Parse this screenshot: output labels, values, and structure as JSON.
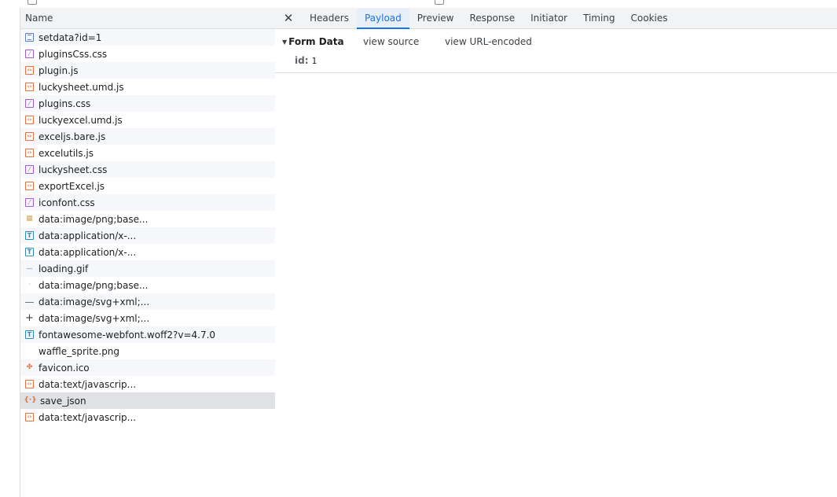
{
  "request_list": {
    "column_header": "Name",
    "items": [
      {
        "name": "setdata?id=1",
        "icon": "document-icon",
        "type": "doc"
      },
      {
        "name": "pluginsCss.css",
        "icon": "css-file-icon",
        "type": "css"
      },
      {
        "name": "plugin.js",
        "icon": "script-file-icon",
        "type": "js"
      },
      {
        "name": "luckysheet.umd.js",
        "icon": "script-file-icon",
        "type": "js"
      },
      {
        "name": "plugins.css",
        "icon": "css-file-icon",
        "type": "css"
      },
      {
        "name": "luckyexcel.umd.js",
        "icon": "script-file-icon",
        "type": "js"
      },
      {
        "name": "exceljs.bare.js",
        "icon": "script-file-icon",
        "type": "js"
      },
      {
        "name": "excelutils.js",
        "icon": "script-file-icon",
        "type": "js"
      },
      {
        "name": "luckysheet.css",
        "icon": "css-file-icon",
        "type": "css"
      },
      {
        "name": "exportExcel.js",
        "icon": "script-file-icon",
        "type": "js"
      },
      {
        "name": "iconfont.css",
        "icon": "css-file-icon",
        "type": "css"
      },
      {
        "name": "data:image/png;base...",
        "icon": "image-thumbnail-icon",
        "type": "img"
      },
      {
        "name": "data:application/x-...",
        "icon": "font-file-icon",
        "type": "font"
      },
      {
        "name": "data:application/x-...",
        "icon": "font-file-icon",
        "type": "font"
      },
      {
        "name": "loading.gif",
        "icon": "gif-thumbnail-icon",
        "type": "gif"
      },
      {
        "name": "data:image/png;base...",
        "icon": "image-thumbnail-icon",
        "type": "img2"
      },
      {
        "name": "data:image/svg+xml;...",
        "icon": "minus-icon",
        "type": "dash"
      },
      {
        "name": "data:image/svg+xml;...",
        "icon": "plus-icon",
        "type": "plus"
      },
      {
        "name": "fontawesome-webfont.woff2?v=4.7.0",
        "icon": "font-file-icon",
        "type": "font"
      },
      {
        "name": "waffle_sprite.png",
        "icon": "image-thumbnail-icon",
        "type": "blank"
      },
      {
        "name": "favicon.ico",
        "icon": "favicon-icon",
        "type": "fav"
      },
      {
        "name": "data:text/javascrip...",
        "icon": "script-file-icon",
        "type": "js"
      },
      {
        "name": "save_json",
        "icon": "json-icon",
        "type": "json",
        "selected": true
      },
      {
        "name": "data:text/javascrip...",
        "icon": "script-file-icon",
        "type": "js"
      }
    ]
  },
  "detail": {
    "close_glyph": "✕",
    "tabs": [
      {
        "label": "Headers",
        "active": false
      },
      {
        "label": "Payload",
        "active": true
      },
      {
        "label": "Preview",
        "active": false
      },
      {
        "label": "Response",
        "active": false
      },
      {
        "label": "Initiator",
        "active": false
      },
      {
        "label": "Timing",
        "active": false
      },
      {
        "label": "Cookies",
        "active": false
      }
    ],
    "form_data": {
      "title": "Form Data",
      "view_source": "view source",
      "view_url_encoded": "view URL-encoded",
      "params": [
        {
          "key": "id:",
          "value": "1"
        }
      ]
    }
  },
  "colors": {
    "accent": "#1a73e8",
    "css": "#a45ad4",
    "js": "#e8703a",
    "doc": "#5f7ec8",
    "font": "#2b8cc4",
    "selected_row": "#dfe1e5"
  }
}
